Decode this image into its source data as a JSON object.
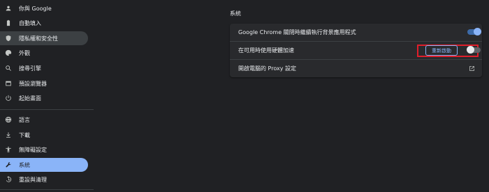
{
  "sidebar": {
    "items": [
      {
        "label": "你與 Google",
        "icon": "person-icon"
      },
      {
        "label": "自動填入",
        "icon": "clipboard-icon"
      },
      {
        "label": "隱私權和安全性",
        "icon": "shield-icon"
      },
      {
        "label": "外觀",
        "icon": "palette-icon"
      },
      {
        "label": "搜尋引擎",
        "icon": "search-icon"
      },
      {
        "label": "預設瀏覽器",
        "icon": "browser-icon"
      },
      {
        "label": "起始畫面",
        "icon": "power-icon"
      },
      {
        "label": "語言",
        "icon": "globe-icon"
      },
      {
        "label": "下載",
        "icon": "download-icon"
      },
      {
        "label": "無障礙設定",
        "icon": "accessibility-icon"
      },
      {
        "label": "系統",
        "icon": "wrench-icon"
      },
      {
        "label": "重設與清理",
        "icon": "reset-icon"
      }
    ]
  },
  "main": {
    "section_title": "系統",
    "rows": [
      {
        "label": "Google Chrome 關閉時繼續執行背景應用程式",
        "toggle": "on"
      },
      {
        "label": "在可用時使用硬體加速",
        "toggle": "off",
        "button_label": "重新啟動"
      },
      {
        "label": "開啟電腦的 Proxy 設定",
        "icon": "open-in-new-icon"
      }
    ]
  },
  "colors": {
    "background": "#202124",
    "card": "#292a2d",
    "accent": "#8ab4f8",
    "highlight": "#e01e2b"
  }
}
